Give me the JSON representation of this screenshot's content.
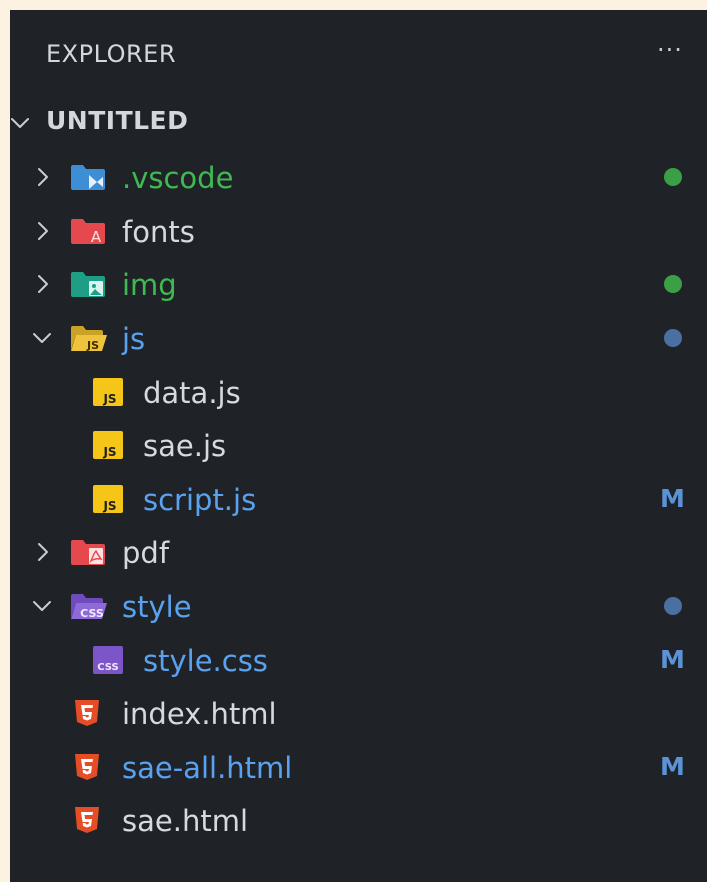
{
  "explorer": {
    "title": "EXPLORER",
    "more_label": "···"
  },
  "root": {
    "label": "UNTITLED"
  },
  "tree": [
    {
      "name": ".vscode",
      "kind": "folder",
      "expanded": false,
      "status": "dot",
      "color": "#3fb950",
      "icon": "vscode-folder-icon"
    },
    {
      "name": "fonts",
      "kind": "folder",
      "expanded": false,
      "status": "",
      "color": "#d6d9de",
      "icon": "font-folder-icon"
    },
    {
      "name": "img",
      "kind": "folder",
      "expanded": false,
      "status": "dot",
      "color": "#3fb950",
      "icon": "images-folder-icon"
    },
    {
      "name": "js",
      "kind": "folder",
      "expanded": true,
      "status": "dot",
      "color": "#5aa2f0",
      "icon": "js-folder-open-icon"
    },
    {
      "name": "data.js",
      "kind": "file",
      "status": "",
      "color": "#d6d9de",
      "icon": "js-file-icon"
    },
    {
      "name": "sae.js",
      "kind": "file",
      "status": "",
      "color": "#d6d9de",
      "icon": "js-file-icon"
    },
    {
      "name": "script.js",
      "kind": "file",
      "status": "M",
      "color": "#5aa2f0",
      "icon": "js-file-icon"
    },
    {
      "name": "pdf",
      "kind": "folder",
      "expanded": false,
      "status": "",
      "color": "#d6d9de",
      "icon": "pdf-folder-icon"
    },
    {
      "name": "style",
      "kind": "folder",
      "expanded": true,
      "status": "dot",
      "color": "#5aa2f0",
      "icon": "css-folder-open-icon"
    },
    {
      "name": "style.css",
      "kind": "file",
      "status": "M",
      "color": "#5aa2f0",
      "icon": "css-file-icon"
    },
    {
      "name": "index.html",
      "kind": "file",
      "status": "",
      "color": "#d6d9de",
      "icon": "html-file-icon"
    },
    {
      "name": "sae-all.html",
      "kind": "file",
      "status": "M",
      "color": "#5aa2f0",
      "icon": "html-file-icon"
    },
    {
      "name": "sae.html",
      "kind": "file",
      "status": "",
      "color": "#d6d9de",
      "icon": "html-file-icon"
    }
  ],
  "colors": {
    "background": "#1f2328",
    "modified": "#5b93d6",
    "untracked_green": "#3fb950",
    "dot_blue": "#4a6fa0"
  }
}
